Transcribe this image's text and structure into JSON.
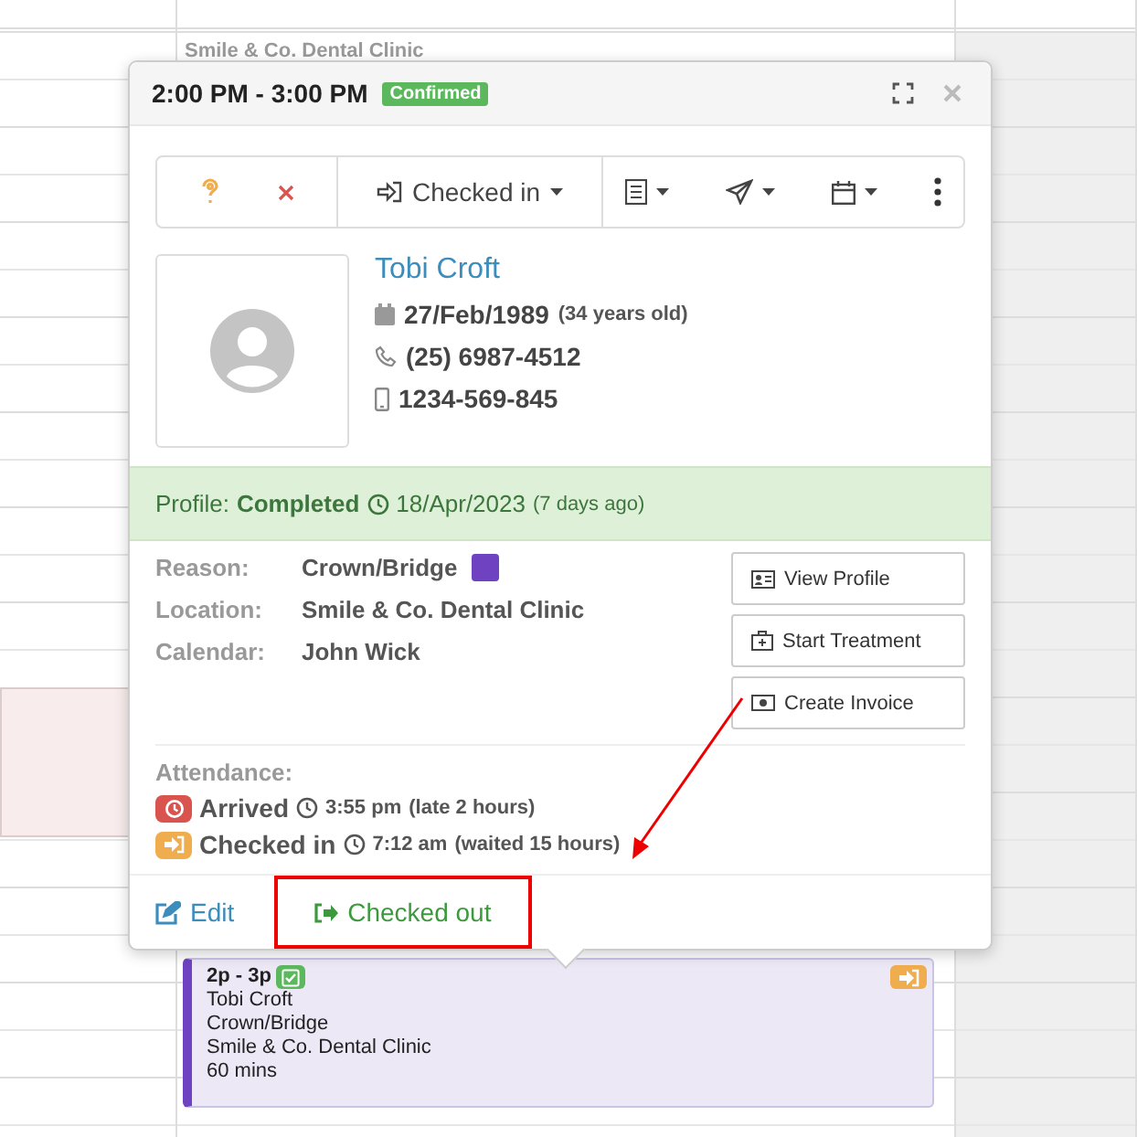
{
  "calendar": {
    "top_event_text": "Smile & Co. Dental Clinic",
    "event": {
      "time": "2p - 3p",
      "confirmed": true,
      "checked_in": true,
      "patient": "Tobi Croft",
      "reason": "Crown/Bridge",
      "location": "Smile & Co. Dental Clinic",
      "duration": "60 mins",
      "color": "#6f42c1"
    }
  },
  "popover": {
    "title": "2:00 PM - 3:00 PM",
    "status_badge": "Confirmed",
    "toolbar": {
      "status_menu": "Checked in"
    },
    "patient": {
      "name": "Tobi Croft",
      "birth_date": "27/Feb/1989",
      "age": "(34 years old)",
      "phone": "(25) 6987-4512",
      "mobile": "1234-569-845"
    },
    "profile": {
      "label": "Profile:",
      "status": "Completed",
      "date": "18/Apr/2023",
      "ago": "(7 days ago)"
    },
    "details": [
      {
        "label": "Reason:",
        "value": "Crown/Bridge",
        "color": "#6f42c1"
      },
      {
        "label": "Location:",
        "value": "Smile & Co. Dental Clinic"
      },
      {
        "label": "Calendar:",
        "value": "John Wick"
      }
    ],
    "actions": [
      {
        "kind": "profile",
        "label": "View Profile"
      },
      {
        "kind": "treatment",
        "label": "Start Treatment"
      },
      {
        "kind": "invoice",
        "label": "Create Invoice"
      }
    ],
    "attendance": {
      "heading": "Attendance:",
      "entries": [
        {
          "kind": "arrived",
          "label": "Arrived",
          "time": "3:55 pm",
          "note": "(late 2 hours)"
        },
        {
          "kind": "checked_in",
          "label": "Checked in",
          "time": "7:12 am",
          "note": "(waited 15 hours)"
        }
      ]
    },
    "footer": {
      "edit": "Edit",
      "checkout": "Checked out",
      "highlighted": true
    }
  }
}
